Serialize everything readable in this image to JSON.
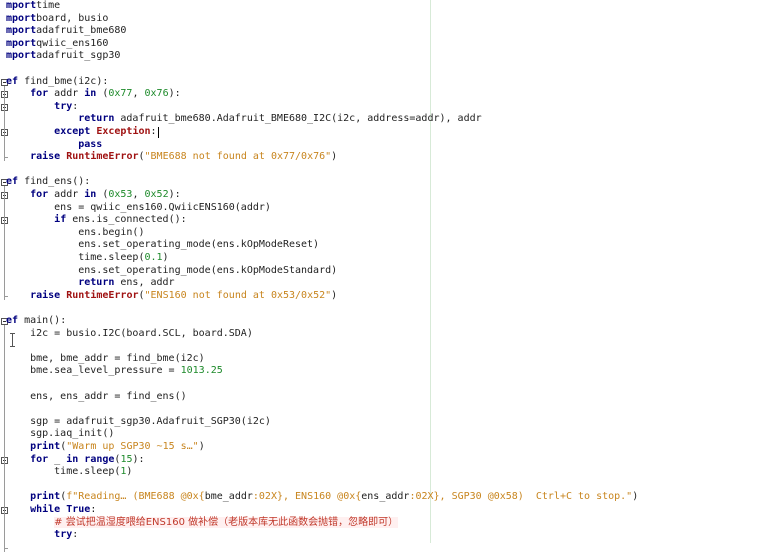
{
  "editor": {
    "code_lines": [
      {
        "tokens": [
          [
            "kw",
            "mport"
          ],
          [
            "",
            "time"
          ]
        ]
      },
      {
        "tokens": [
          [
            "kw",
            "mport"
          ],
          [
            "",
            "board, busio"
          ]
        ]
      },
      {
        "tokens": [
          [
            "kw",
            "mport"
          ],
          [
            "",
            "adafruit_bme680"
          ]
        ]
      },
      {
        "tokens": [
          [
            "kw",
            "mport"
          ],
          [
            "",
            "qwiic_ens160"
          ]
        ]
      },
      {
        "tokens": [
          [
            "kw",
            "mport"
          ],
          [
            "",
            "adafruit_sgp30"
          ]
        ]
      },
      {
        "tokens": []
      },
      {
        "tokens": [
          [
            "kw",
            "ef"
          ],
          [
            "",
            " find_bme(i2c):"
          ]
        ]
      },
      {
        "tokens": [
          [
            "",
            "    "
          ],
          [
            "kw",
            "for"
          ],
          [
            "",
            " addr "
          ],
          [
            "kw",
            "in"
          ],
          [
            "",
            " ("
          ],
          [
            "num",
            "0x77"
          ],
          [
            "",
            ", "
          ],
          [
            "num",
            "0x76"
          ],
          [
            "",
            "):"
          ]
        ]
      },
      {
        "tokens": [
          [
            "",
            "        "
          ],
          [
            "kw",
            "try"
          ],
          [
            "",
            ":"
          ]
        ]
      },
      {
        "tokens": [
          [
            "",
            "            "
          ],
          [
            "kw",
            "return"
          ],
          [
            "",
            " adafruit_bme680.Adafruit_BME680_I2C(i2c, address=addr), addr"
          ]
        ]
      },
      {
        "tokens": [
          [
            "",
            "        "
          ],
          [
            "kw",
            "except"
          ],
          [
            "",
            " "
          ],
          [
            "exc",
            "Exception"
          ],
          [
            "",
            ":"
          ]
        ]
      },
      {
        "tokens": [
          [
            "",
            "            "
          ],
          [
            "kw",
            "pass"
          ]
        ]
      },
      {
        "tokens": [
          [
            "",
            "    "
          ],
          [
            "kw",
            "raise"
          ],
          [
            "",
            " "
          ],
          [
            "exc",
            "RuntimeError"
          ],
          [
            "",
            "("
          ],
          [
            "str",
            "\"BME688 not found at 0x77/0x76\""
          ],
          [
            "",
            ")"
          ]
        ]
      },
      {
        "tokens": []
      },
      {
        "tokens": [
          [
            "kw",
            "ef"
          ],
          [
            "",
            " find_ens():"
          ]
        ]
      },
      {
        "tokens": [
          [
            "",
            "    "
          ],
          [
            "kw",
            "for"
          ],
          [
            "",
            " addr "
          ],
          [
            "kw",
            "in"
          ],
          [
            "",
            " ("
          ],
          [
            "num",
            "0x53"
          ],
          [
            "",
            ", "
          ],
          [
            "num",
            "0x52"
          ],
          [
            "",
            "):"
          ]
        ]
      },
      {
        "tokens": [
          [
            "",
            "        ens = qwiic_ens160.QwiicENS160(addr)"
          ]
        ]
      },
      {
        "tokens": [
          [
            "",
            "        "
          ],
          [
            "kw",
            "if"
          ],
          [
            "",
            " ens.is_connected():"
          ]
        ]
      },
      {
        "tokens": [
          [
            "",
            "            ens.begin()"
          ]
        ]
      },
      {
        "tokens": [
          [
            "",
            "            ens.set_operating_mode(ens.kOpModeReset)"
          ]
        ]
      },
      {
        "tokens": [
          [
            "",
            "            time.sleep("
          ],
          [
            "num",
            "0.1"
          ],
          [
            "",
            ")"
          ]
        ]
      },
      {
        "tokens": [
          [
            "",
            "            ens.set_operating_mode(ens.kOpModeStandard)"
          ]
        ]
      },
      {
        "tokens": [
          [
            "",
            "            "
          ],
          [
            "kw",
            "return"
          ],
          [
            "",
            " ens, addr"
          ]
        ]
      },
      {
        "tokens": [
          [
            "",
            "    "
          ],
          [
            "kw",
            "raise"
          ],
          [
            "",
            " "
          ],
          [
            "exc",
            "RuntimeError"
          ],
          [
            "",
            "("
          ],
          [
            "str",
            "\"ENS160 not found at 0x53/0x52\""
          ],
          [
            "",
            ")"
          ]
        ]
      },
      {
        "tokens": []
      },
      {
        "tokens": [
          [
            "kw",
            "ef"
          ],
          [
            "",
            " main():"
          ]
        ]
      },
      {
        "tokens": [
          [
            "",
            "    i2c = busio.I2C(board.SCL, board.SDA)"
          ]
        ]
      },
      {
        "tokens": []
      },
      {
        "tokens": [
          [
            "",
            "    bme, bme_addr = find_bme(i2c)"
          ]
        ]
      },
      {
        "tokens": [
          [
            "",
            "    bme.sea_level_pressure = "
          ],
          [
            "num",
            "1013.25"
          ]
        ]
      },
      {
        "tokens": []
      },
      {
        "tokens": [
          [
            "",
            "    ens, ens_addr = find_ens()"
          ]
        ]
      },
      {
        "tokens": []
      },
      {
        "tokens": [
          [
            "",
            "    sgp = adafruit_sgp30.Adafruit_SGP30(i2c)"
          ]
        ]
      },
      {
        "tokens": [
          [
            "",
            "    sgp.iaq_init()"
          ]
        ]
      },
      {
        "tokens": [
          [
            "",
            "    "
          ],
          [
            "kw",
            "print"
          ],
          [
            "",
            "("
          ],
          [
            "str",
            "\"Warm up SGP30 ~15 s…\""
          ],
          [
            "",
            ")"
          ]
        ]
      },
      {
        "tokens": [
          [
            "",
            "    "
          ],
          [
            "kw",
            "for"
          ],
          [
            "",
            " _ "
          ],
          [
            "kw",
            "in"
          ],
          [
            "",
            " "
          ],
          [
            "kw",
            "range"
          ],
          [
            "",
            "("
          ],
          [
            "num",
            "15"
          ],
          [
            "",
            "):"
          ]
        ]
      },
      {
        "tokens": [
          [
            "",
            "        time.sleep("
          ],
          [
            "num",
            "1"
          ],
          [
            "",
            ")"
          ]
        ]
      },
      {
        "tokens": []
      },
      {
        "tokens": [
          [
            "",
            "    "
          ],
          [
            "kw",
            "print"
          ],
          [
            "",
            "("
          ],
          [
            "str",
            "f\"Reading… (BME688 @0x{"
          ],
          [
            "",
            "bme_addr"
          ],
          [
            "str",
            ":02X}, ENS160 @0x{"
          ],
          [
            "",
            "ens_addr"
          ],
          [
            "str",
            ":02X}, SGP30 @0x58)  Ctrl+C to stop.\""
          ],
          [
            "",
            ")"
          ]
        ]
      },
      {
        "tokens": [
          [
            "",
            "    "
          ],
          [
            "kw",
            "while"
          ],
          [
            "",
            " "
          ],
          [
            "kw",
            "True"
          ],
          [
            "",
            ":"
          ]
        ]
      },
      {
        "tokens": [
          [
            "",
            "        "
          ],
          [
            "cmt",
            "# 尝试把温湿度喂给ENS160 做补偿（老版本库无此函数会抛错，忽略即可）"
          ]
        ]
      },
      {
        "tokens": [
          [
            "",
            "        "
          ],
          [
            "kw",
            "try"
          ],
          [
            "",
            ":"
          ]
        ]
      }
    ]
  },
  "icons": {
    "fold_marker": "fold-minus-icon",
    "mouse_cursor": "text-cursor-icon"
  },
  "colors": {
    "keyword": "#00007f",
    "exception": "#a01313",
    "string": "#c8851e",
    "number": "#1d8a2a",
    "comment": "#c0392b",
    "edge_marker": "#d7ead7"
  }
}
